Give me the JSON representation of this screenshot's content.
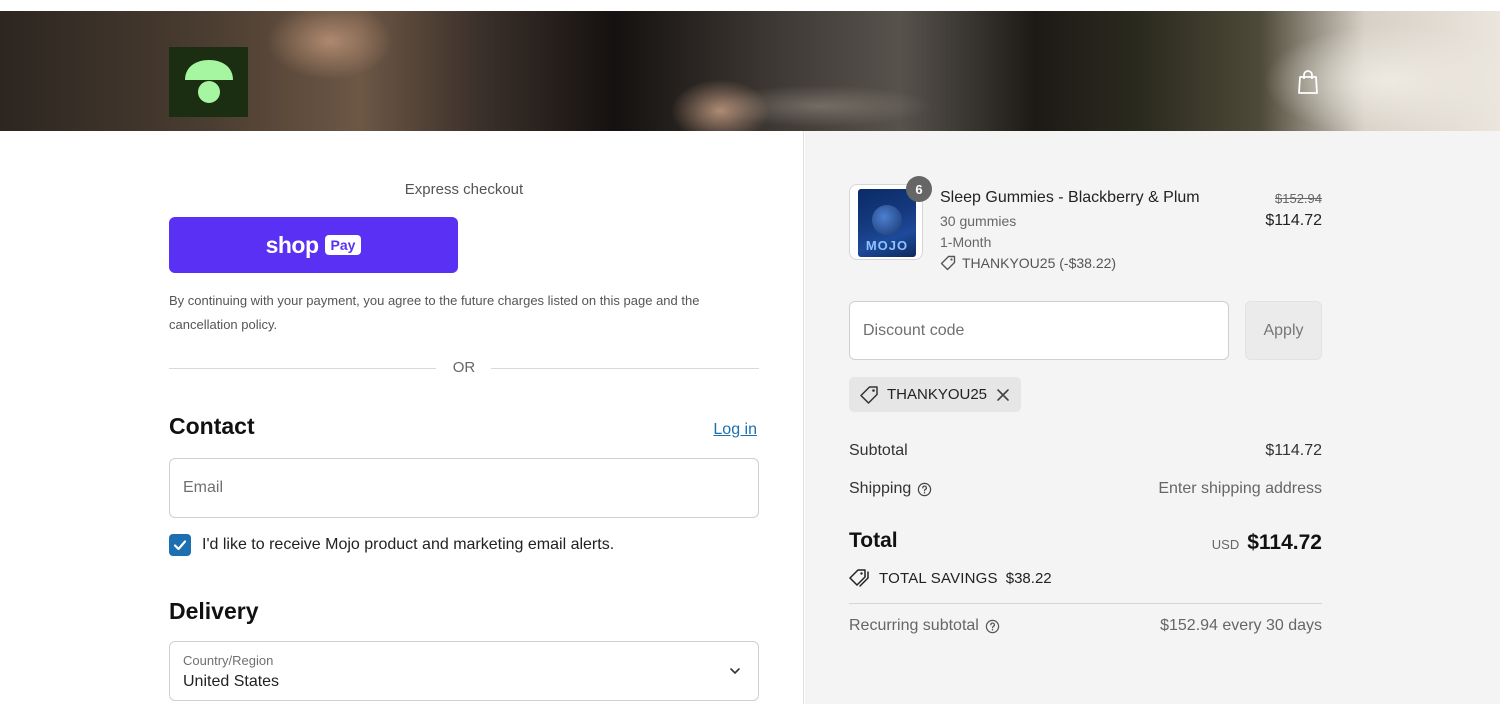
{
  "header": {
    "brand": "Mojo",
    "logo_icon": "mushroom-logo-icon",
    "cart_icon": "shopping-bag-icon",
    "colors": {
      "logo_bg": "#1c2e12",
      "logo_fg": "#a6f5a0"
    }
  },
  "express": {
    "title": "Express checkout",
    "shop_button": {
      "word": "shop",
      "pill": "Pay"
    },
    "consent_text": "By continuing with your payment, you agree to the future charges listed on this page and the cancellation policy.",
    "or_label": "OR"
  },
  "contact": {
    "title": "Contact",
    "login_link": "Log in",
    "email_placeholder": "Email",
    "marketing_checkbox": {
      "checked": true,
      "label": "I'd like to receive Mojo product and marketing email alerts."
    }
  },
  "delivery": {
    "title": "Delivery",
    "country_label": "Country/Region",
    "country_value": "United States"
  },
  "order": {
    "item": {
      "name": "Sleep Gummies - Blackberry & Plum",
      "variant": "30 gummies",
      "plan": "1-Month",
      "discount": "THANKYOU25 (-$38.22)",
      "quantity": "6",
      "original_price": "$152.94",
      "price": "$114.72",
      "thumb_brand": "MOJO"
    },
    "discount_placeholder": "Discount code",
    "apply_label": "Apply",
    "applied_code": "THANKYOU25",
    "subtotal_label": "Subtotal",
    "subtotal_value": "$114.72",
    "shipping_label": "Shipping",
    "shipping_value": "Enter shipping address",
    "total_label": "Total",
    "total_currency": "USD",
    "total_value": "$114.72",
    "savings_label": "TOTAL SAVINGS",
    "savings_value": "$38.22",
    "recurring_label": "Recurring subtotal",
    "recurring_value": "$152.94 every 30 days"
  },
  "colors": {
    "accent": "#1c6fb1",
    "shop_pay": "#5a31f4",
    "sidebar_bg": "#f4f4f4"
  }
}
